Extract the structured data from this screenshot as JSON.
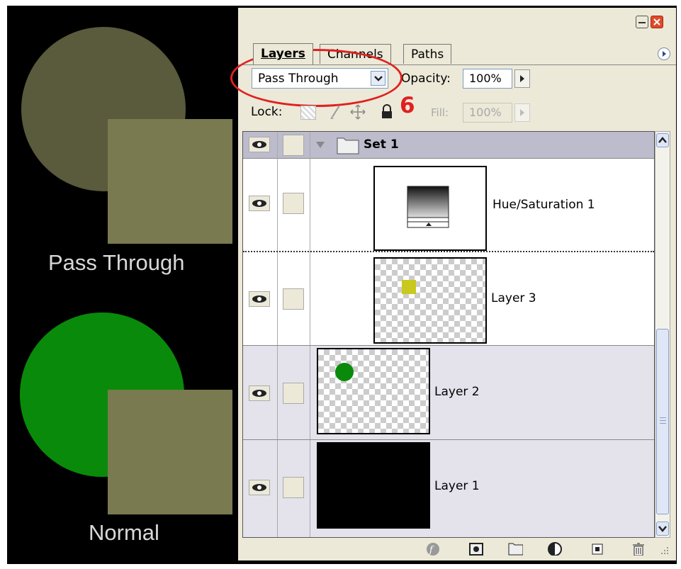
{
  "artwork": {
    "label_top": "Pass Through",
    "label_bottom": "Normal",
    "colors": {
      "top_circle": "#5a5a3c",
      "square": "#7a7a50",
      "bottom_circle": "#0a8a0a"
    }
  },
  "panel": {
    "tabs": [
      {
        "label": "Layers",
        "active": true
      },
      {
        "label": "Channels",
        "active": false
      },
      {
        "label": "Paths",
        "active": false
      }
    ],
    "blend_mode": "Pass Through",
    "opacity_label": "Opacity:",
    "opacity_value": "100%",
    "lock_label": "Lock:",
    "fill_label": "Fill:",
    "fill_value": "100%",
    "annotation_number": "6",
    "layers": [
      {
        "name": "Set 1",
        "type": "group",
        "expanded": true
      },
      {
        "name": "Hue/Saturation 1",
        "type": "adjustment"
      },
      {
        "name": "Layer 3",
        "type": "pixel",
        "swatch": "#c8c81e"
      },
      {
        "name": "Layer 2",
        "type": "pixel",
        "swatch": "#0a8a0a"
      },
      {
        "name": "Layer 1",
        "type": "pixel",
        "swatch": "#000000"
      }
    ],
    "footer_icons": [
      "link-layers-icon",
      "layer-style-icon",
      "layer-mask-icon",
      "new-set-icon",
      "adjustment-layer-icon",
      "new-layer-icon",
      "trash-icon"
    ]
  }
}
